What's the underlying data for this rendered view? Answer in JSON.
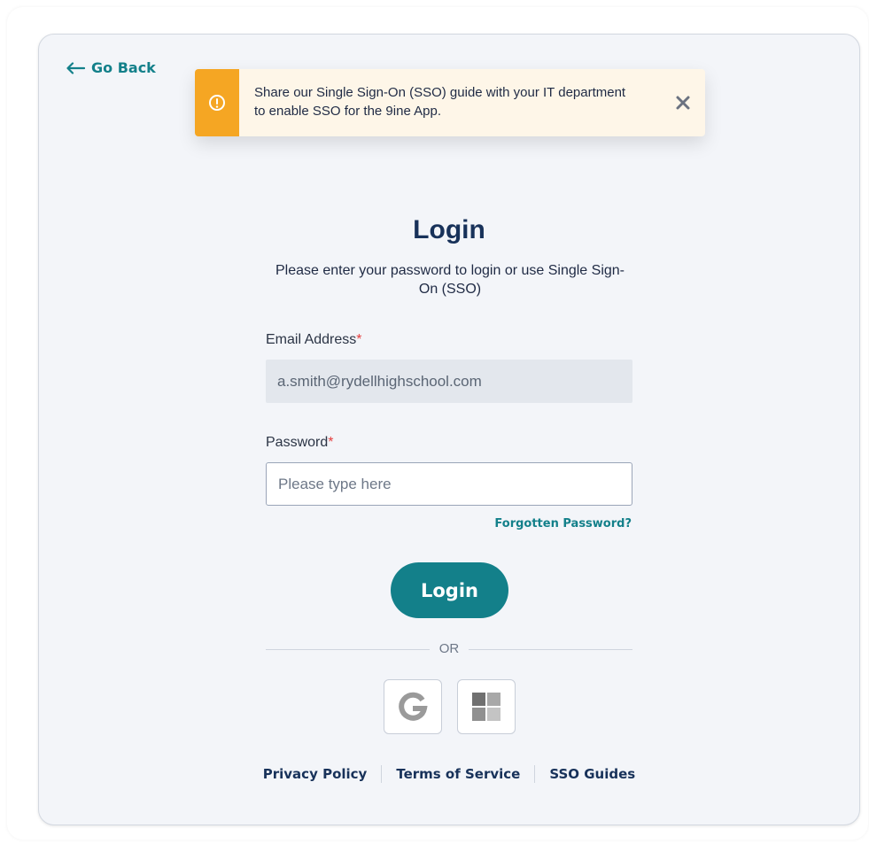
{
  "nav": {
    "go_back_label": "Go Back"
  },
  "toast": {
    "message": "Share our Single Sign-On (SSO) guide with your IT department to enable SSO for the 9ine App.",
    "accent_color": "#f5a623",
    "icon": "alert-icon",
    "close_icon": "close-icon"
  },
  "login": {
    "title": "Login",
    "subtitle": "Please enter your password to login or use Single Sign-On (SSO)",
    "email_label": "Email Address",
    "email_value": "a.smith@rydellhighschool.com",
    "password_label": "Password",
    "password_placeholder": "Please type here",
    "required_marker": "*",
    "forgot_password": "Forgotten Password?",
    "submit_label": "Login",
    "divider_text": "OR",
    "brand_color": "#13808a"
  },
  "sso": [
    {
      "provider": "Google",
      "icon": "google-icon"
    },
    {
      "provider": "Microsoft",
      "icon": "microsoft-icon"
    }
  ],
  "footer": {
    "privacy": "Privacy Policy",
    "terms": "Terms of Service",
    "guides": "SSO Guides"
  }
}
